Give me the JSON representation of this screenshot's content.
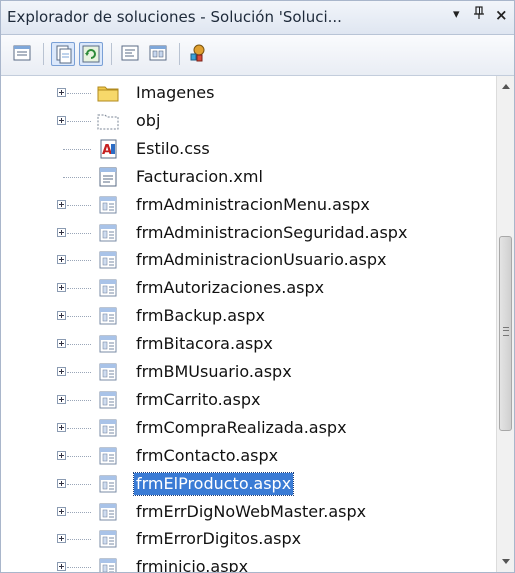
{
  "window": {
    "title": "Explorador de soluciones - Solución 'Soluci...",
    "dropdown_glyph": "▾",
    "pin_glyph": "ᵖ",
    "close_glyph": "×"
  },
  "toolbar": {
    "buttons": [
      {
        "name": "properties-icon",
        "active": false
      },
      {
        "name": "show-all-files-icon",
        "active": true
      },
      {
        "name": "refresh-icon",
        "active": true
      },
      {
        "name": "view-code-icon",
        "active": false
      },
      {
        "name": "view-designer-icon",
        "active": false
      },
      {
        "name": "class-diagram-icon",
        "active": false
      }
    ]
  },
  "tree": {
    "items": [
      {
        "label": "Imagenes",
        "icon": "folder-icon",
        "expandable": true,
        "selected": false
      },
      {
        "label": "obj",
        "icon": "folder-dashed-icon",
        "expandable": true,
        "selected": false
      },
      {
        "label": "Estilo.css",
        "icon": "css-file-icon",
        "expandable": false,
        "selected": false
      },
      {
        "label": "Facturacion.xml",
        "icon": "xml-file-icon",
        "expandable": false,
        "selected": false
      },
      {
        "label": "frmAdministracionMenu.aspx",
        "icon": "aspx-file-icon",
        "expandable": true,
        "selected": false
      },
      {
        "label": "frmAdministracionSeguridad.aspx",
        "icon": "aspx-file-icon",
        "expandable": true,
        "selected": false
      },
      {
        "label": "frmAdministracionUsuario.aspx",
        "icon": "aspx-file-icon",
        "expandable": true,
        "selected": false
      },
      {
        "label": "frmAutorizaciones.aspx",
        "icon": "aspx-file-icon",
        "expandable": true,
        "selected": false
      },
      {
        "label": "frmBackup.aspx",
        "icon": "aspx-file-icon",
        "expandable": true,
        "selected": false
      },
      {
        "label": "frmBitacora.aspx",
        "icon": "aspx-file-icon",
        "expandable": true,
        "selected": false
      },
      {
        "label": "frmBMUsuario.aspx",
        "icon": "aspx-file-icon",
        "expandable": true,
        "selected": false
      },
      {
        "label": "frmCarrito.aspx",
        "icon": "aspx-file-icon",
        "expandable": true,
        "selected": false
      },
      {
        "label": "frmCompraRealizada.aspx",
        "icon": "aspx-file-icon",
        "expandable": true,
        "selected": false
      },
      {
        "label": "frmContacto.aspx",
        "icon": "aspx-file-icon",
        "expandable": true,
        "selected": false
      },
      {
        "label": "frmElProducto.aspx",
        "icon": "aspx-file-icon",
        "expandable": true,
        "selected": true
      },
      {
        "label": "frmErrDigNoWebMaster.aspx",
        "icon": "aspx-file-icon",
        "expandable": true,
        "selected": false
      },
      {
        "label": "frmErrorDigitos.aspx",
        "icon": "aspx-file-icon",
        "expandable": true,
        "selected": false
      },
      {
        "label": "frminicio.aspx",
        "icon": "aspx-file-icon",
        "expandable": true,
        "selected": false
      }
    ]
  },
  "colors": {
    "selection": "#3a7bd5",
    "folder": "#f2c94c",
    "border": "#a9b6cb"
  }
}
